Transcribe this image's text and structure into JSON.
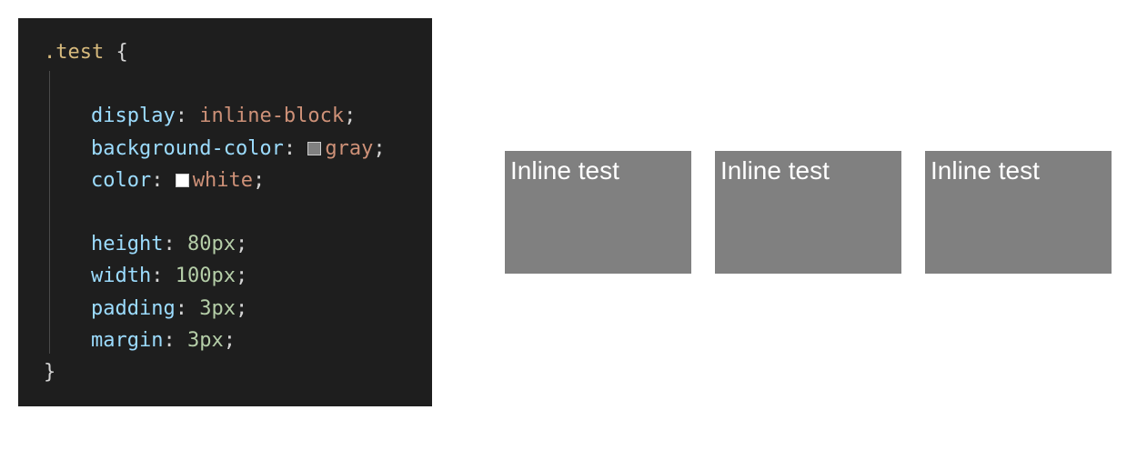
{
  "code": {
    "selector": ".test",
    "openBrace": "{",
    "closeBrace": "}",
    "lines": [
      {
        "property": "display",
        "value": "inline-block",
        "valueType": "keyword"
      },
      {
        "property": "background-color",
        "value": "gray",
        "valueType": "color",
        "swatch": "gray"
      },
      {
        "property": "color",
        "value": "white",
        "valueType": "color",
        "swatch": "white"
      },
      {
        "blank": true
      },
      {
        "property": "height",
        "value": "80px",
        "valueType": "number"
      },
      {
        "property": "width",
        "value": "100px",
        "valueType": "number"
      },
      {
        "property": "padding",
        "value": "3px",
        "valueType": "number"
      },
      {
        "property": "margin",
        "value": "3px",
        "valueType": "number"
      }
    ]
  },
  "preview": {
    "boxes": [
      {
        "label": "Inline test"
      },
      {
        "label": "Inline test"
      },
      {
        "label": "Inline test"
      }
    ]
  }
}
